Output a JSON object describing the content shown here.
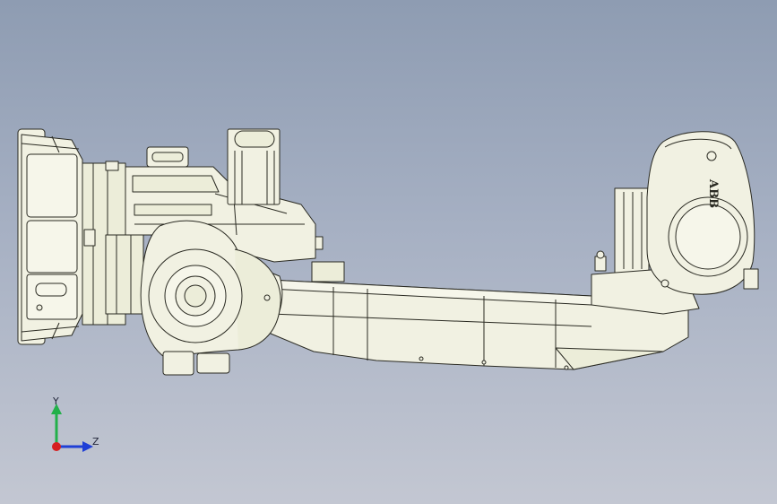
{
  "viewport": {
    "background_top": "#8e9cb2",
    "background_bottom": "#c3c7d2"
  },
  "model": {
    "brand_label": "ABB",
    "part_color": "#f1f1e2",
    "edge_color": "#2a2a22",
    "shade_color": "#d9dac6"
  },
  "triad": {
    "y_label": "Y",
    "z_label": "Z",
    "y_axis_color": "#22b04a",
    "z_axis_color": "#1f3fd6",
    "x_axis_color": "#d61f1f"
  }
}
